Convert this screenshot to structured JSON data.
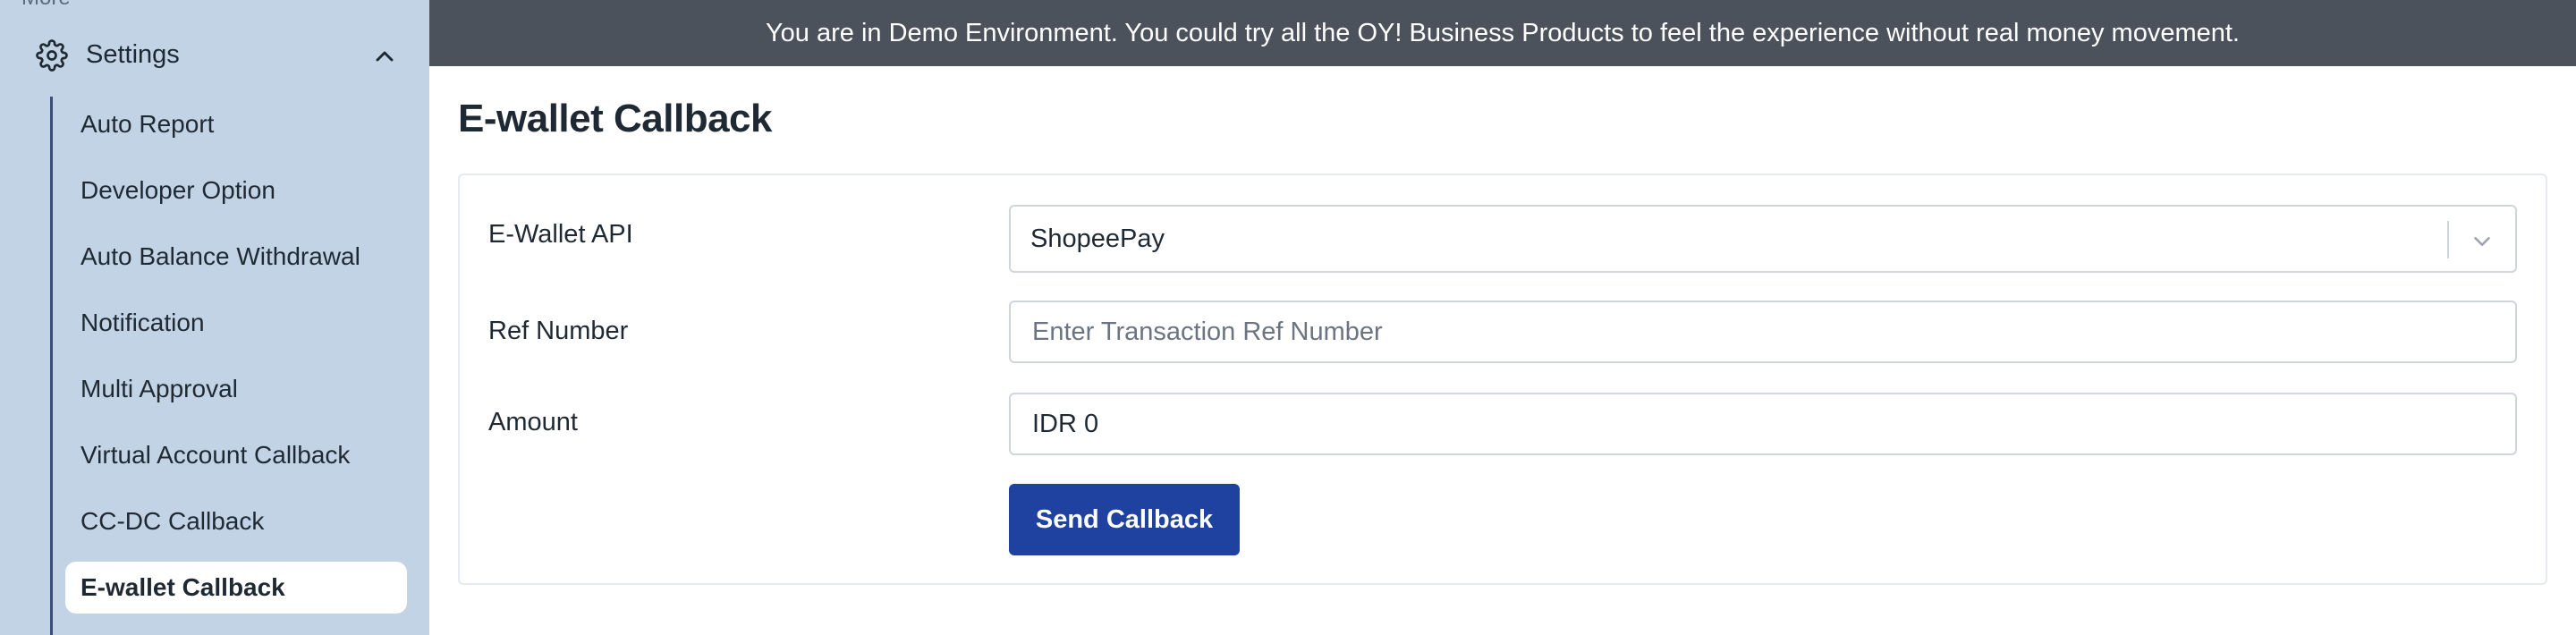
{
  "sidebar": {
    "cut_label": "More",
    "settings": {
      "label": "Settings",
      "icon": "gear-icon",
      "expand_icon": "chevron-up-icon"
    },
    "items": [
      {
        "label": "Auto Report"
      },
      {
        "label": "Developer Option"
      },
      {
        "label": "Auto Balance Withdrawal"
      },
      {
        "label": "Notification"
      },
      {
        "label": "Multi Approval"
      },
      {
        "label": "Virtual Account Callback"
      },
      {
        "label": "CC-DC Callback"
      },
      {
        "label": "E-wallet Callback",
        "active": true
      }
    ]
  },
  "banner": {
    "text": "You are in Demo Environment. You could try all the OY! Business Products to feel the experience without real money movement."
  },
  "main": {
    "title": "E-wallet Callback",
    "form": {
      "ewallet_label": "E-Wallet API",
      "ewallet_value": "ShopeePay",
      "ref_label": "Ref Number",
      "ref_placeholder": "Enter Transaction Ref Number",
      "ref_value": "",
      "amount_label": "Amount",
      "amount_value": "IDR 0",
      "submit_label": "Send Callback"
    }
  },
  "colors": {
    "sidebar_bg": "#c2d3e6",
    "banner_bg": "#4b525b",
    "primary_button": "#1f42a0"
  }
}
